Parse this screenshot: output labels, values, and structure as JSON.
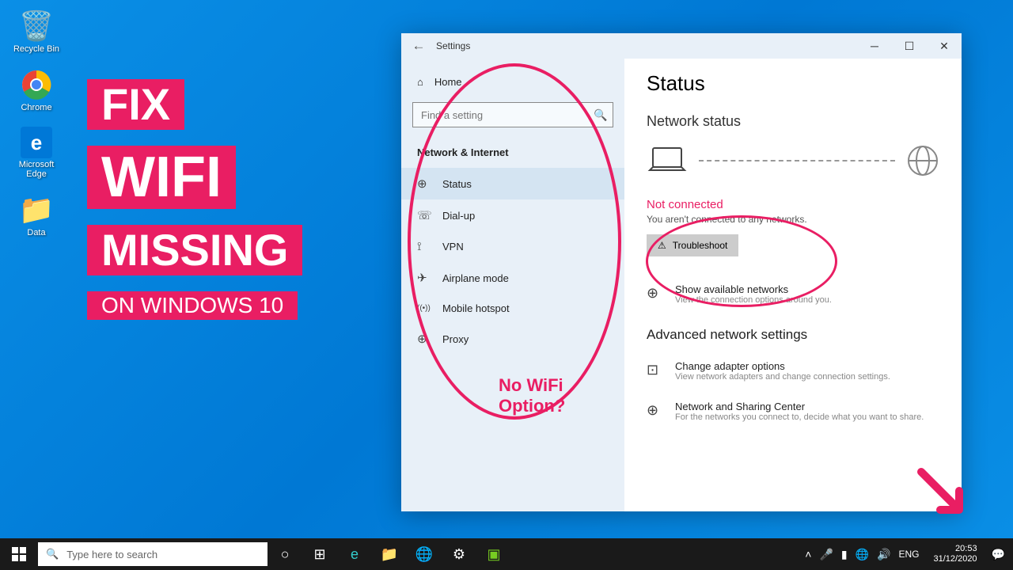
{
  "desktop": {
    "icons": [
      {
        "name": "recycle-bin",
        "label": "Recycle Bin",
        "glyph": "🗑️"
      },
      {
        "name": "chrome",
        "label": "Chrome",
        "glyph": "🌐"
      },
      {
        "name": "edge",
        "label": "Microsoft Edge",
        "glyph": "e"
      },
      {
        "name": "data-folder",
        "label": "Data",
        "glyph": "📁"
      }
    ]
  },
  "overlay": {
    "line1": "FIX",
    "line2": "WIFI",
    "line3": "MISSING",
    "line4": "ON WINDOWS 10",
    "no_wifi_1": "No WiFi",
    "no_wifi_2": "Option?"
  },
  "settings": {
    "title": "Settings",
    "home": "Home",
    "search_placeholder": "Find a setting",
    "section": "Network & Internet",
    "nav": [
      {
        "name": "status",
        "label": "Status",
        "glyph": "⊕",
        "active": true
      },
      {
        "name": "dialup",
        "label": "Dial-up",
        "glyph": "☏",
        "active": false
      },
      {
        "name": "vpn",
        "label": "VPN",
        "glyph": "⟟",
        "active": false
      },
      {
        "name": "airplane",
        "label": "Airplane mode",
        "glyph": "✈",
        "active": false
      },
      {
        "name": "hotspot",
        "label": "Mobile hotspot",
        "glyph": "((•))",
        "active": false
      },
      {
        "name": "proxy",
        "label": "Proxy",
        "glyph": "⊕",
        "active": false
      }
    ],
    "main": {
      "heading": "Status",
      "subheading": "Network status",
      "not_connected": "Not connected",
      "not_connected_sub": "You aren't connected to any networks.",
      "troubleshoot": "Troubleshoot",
      "show_networks": "Show available networks",
      "show_networks_sub": "View the connection options around you.",
      "advanced": "Advanced network settings",
      "adapter": "Change adapter options",
      "adapter_sub": "View network adapters and change connection settings.",
      "sharing": "Network and Sharing Center",
      "sharing_sub": "For the networks you connect to, decide what you want to share."
    }
  },
  "taskbar": {
    "search_placeholder": "Type here to search",
    "lang": "ENG",
    "time": "20:53",
    "date": "31/12/2020"
  }
}
